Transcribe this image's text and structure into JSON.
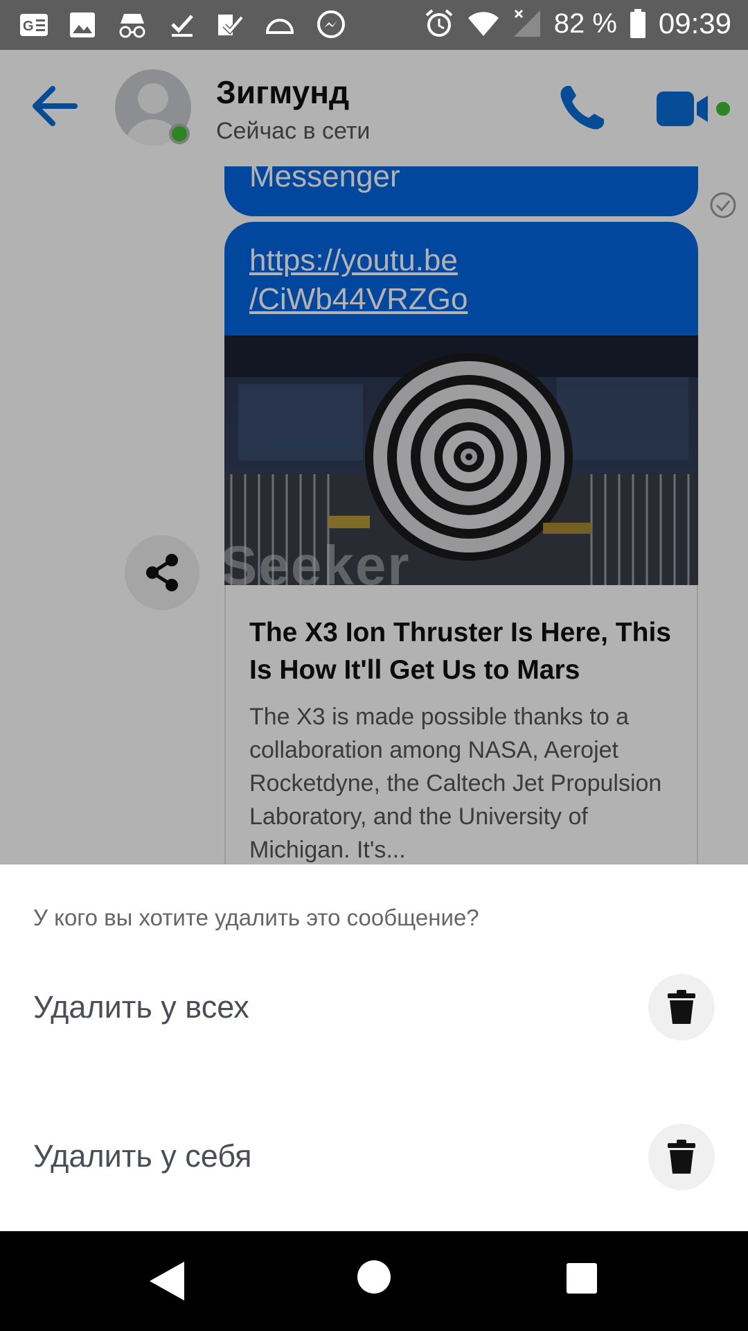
{
  "status_bar": {
    "battery": "82 %",
    "time": "09:39"
  },
  "header": {
    "contact_name": "Зигмунд",
    "contact_status": "Сейчас в сети"
  },
  "messages": {
    "msg1_text": "Messenger",
    "link_text_line1": "https://youtu.be",
    "link_text_line2": "/CiWb44VRZGo",
    "thumbnail_watermark": "Seeker",
    "preview_title": "The X3 Ion Thruster Is Here, This Is How It'll Get Us to Mars",
    "preview_description": "The X3 is made possible thanks to a collaboration among NASA, Aerojet Rocketdyne, the Caltech Jet Propulsion Laboratory, and the University of Michigan. It's..."
  },
  "sheet": {
    "question": "У кого вы хотите удалить это сообщение?",
    "options": [
      {
        "label": "Удалить у всех",
        "icon": "trash-icon"
      },
      {
        "label": "Удалить у себя",
        "icon": "trash-icon"
      }
    ]
  },
  "colors": {
    "accent": "#0466e3",
    "online": "#3fbd32"
  }
}
